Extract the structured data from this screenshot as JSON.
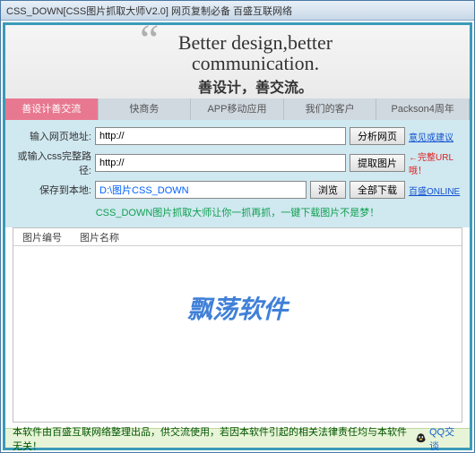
{
  "window": {
    "title": "CSS_DOWN[CSS图片抓取大师V2.0] 网页复制必备 百盛互联网络"
  },
  "banner": {
    "quote": "“",
    "en_line1": "Better design,better",
    "en_line2": "communication.",
    "zh": "善设计，善交流。"
  },
  "tabs": [
    {
      "label": "善设计善交流",
      "active": true
    },
    {
      "label": "快商务",
      "active": false
    },
    {
      "label": "APP移动应用",
      "active": false
    },
    {
      "label": "我们的客户",
      "active": false
    },
    {
      "label": "Packson4周年",
      "active": false
    }
  ],
  "form": {
    "url_label": "输入网页地址:",
    "url_value": "http://",
    "url_btn": "分析网页",
    "url_side": "意见或建议",
    "css_label": "或输入css完整路径:",
    "css_value": "http://",
    "css_btn": "提取图片",
    "css_side": "←完整URL哦！",
    "save_label": "保存到本地:",
    "save_value": "D:\\图片CSS_DOWN",
    "save_btn1": "浏览",
    "save_btn2": "全部下载",
    "save_side": "百盛ONLINE",
    "slogan": "CSS_DOWN图片抓取大师让你一抓再抓，一键下载图片不是梦！"
  },
  "list": {
    "col1": "图片编号",
    "col2": "图片名称",
    "watermark": "飘荡软件"
  },
  "footer": {
    "text": "本软件由百盛互联网络整理出品，供交流使用，若因本软件引起的相关法律责任均与本软件无关！",
    "qq": "QQ交谈"
  }
}
